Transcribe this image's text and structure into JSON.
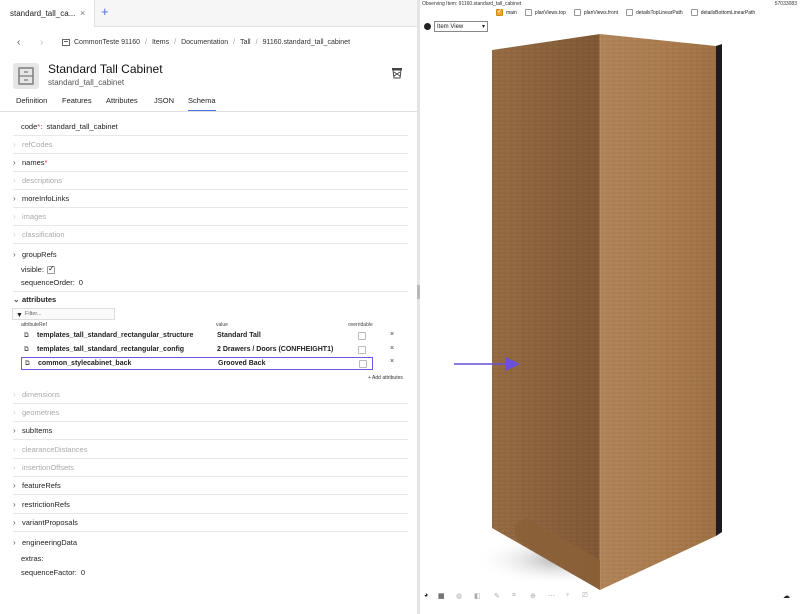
{
  "tabs": {
    "active_label": "standard_tall_ca...",
    "close": "×",
    "add": "+"
  },
  "nav": {
    "back": "‹",
    "forward": "›"
  },
  "breadcrumb": [
    "CommonTeste 91160",
    "Items",
    "Documentation",
    "Tall",
    "91160.standard_tall_cabinet"
  ],
  "item": {
    "title": "Standard Tall Cabinet",
    "code": "standard_tall_cabinet"
  },
  "subtabs": [
    "Definition",
    "Features",
    "Attributes",
    "JSON",
    "Schema"
  ],
  "schema": {
    "code_label": "code",
    "code_required": "*",
    "code_value": "standard_tall_cabinet",
    "refCodes": "refCodes",
    "names": "names",
    "names_required": "*",
    "descriptions": "descriptions",
    "moreInfoLinks": "moreInfoLinks",
    "images": "images",
    "classification": "classification",
    "groupRefs": "groupRefs",
    "visible_label": "visible:",
    "sequenceOrder_label": "sequenceOrder:",
    "sequenceOrder_value": "0",
    "attributes": "attributes",
    "filter_placeholder": "Filter...",
    "col_ref": "attributeRef",
    "col_value": "value",
    "col_overridable": "overridable",
    "attribute_rows": [
      {
        "ref": "templates_tall_standard_rectangular_structure",
        "value": "Standard Tall"
      },
      {
        "ref": "templates_tall_standard_rectangular_config",
        "value": "2 Drawers / Doors (CONFHEIGHT1)"
      },
      {
        "ref": "common_stylecabinet_back",
        "value": "Grooved Back"
      }
    ],
    "delete_glyph": "×",
    "add_attributes": "+ Add attributes",
    "dimensions": "dimensions",
    "geometries": "geometries",
    "subItems": "subItems",
    "clearanceDistances": "clearanceDistances",
    "insertionOffsets": "insertionOffsets",
    "featureRefs": "featureRefs",
    "restrictionRefs": "restrictionRefs",
    "variantProposals": "variantProposals",
    "engineeringData": "engineeringData",
    "extras_label": "extras:",
    "sequenceFactor_label": "sequenceFactor:",
    "sequenceFactor_value": "0"
  },
  "viewer": {
    "observing": "Observing Item: 91160.standard_tall_cabinet",
    "number": "57033083",
    "views": [
      "main",
      "planViews.top",
      "planViews.front",
      "detailsTopLinearPath",
      "detailsBottomLinearPath"
    ],
    "view_select": "Item View",
    "view_select_arrow": "▾",
    "colors": {
      "wood_front": "#a87a4c",
      "wood_side": "#7d5634",
      "wood_edge": "#c49a6c",
      "back_panel": "#1c1c1c",
      "arrow": "#6a4fd8"
    }
  },
  "icons": {
    "tab_close": "close-icon",
    "item_icon": "box-icon",
    "cabinet": "cabinet-icon",
    "external": "external-link-icon",
    "filter": "funnel-icon",
    "eye": "eye-icon",
    "cloud": "cloud-download-icon",
    "grid": "grid-icon"
  }
}
